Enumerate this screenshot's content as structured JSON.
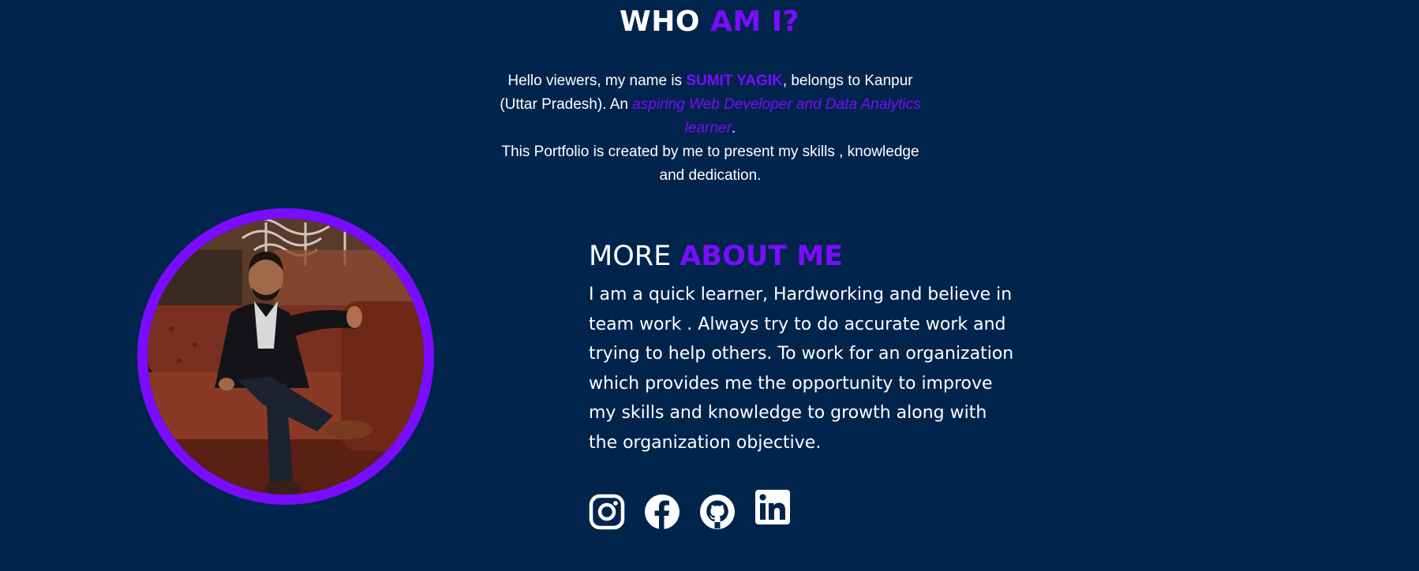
{
  "who": {
    "title_white": "WHO",
    "title_accent": "AM I?"
  },
  "intro": {
    "text_before_name": "Hello viewers, my name is ",
    "name": "SUMIT YAGIK",
    "text_after_name": ", belongs to Kanpur (Uttar Pradesh). An ",
    "role": "aspiring Web Developer and Data Analytics learner",
    "text_after_role": ".",
    "line2": "This Portfolio is created by me to present my skills , knowledge and dedication."
  },
  "about": {
    "title_white": "MORE",
    "title_accent": "ABOUT ME",
    "paragraph": "I am a quick learner, Hardworking and believe in team work . Always try to do accurate work and trying to help others. To work for an organization which provides me the opportunity to improve my skills and knowledge to growth along with the organization objective."
  },
  "socials": [
    {
      "name": "instagram",
      "icon": "instagram-icon"
    },
    {
      "name": "facebook",
      "icon": "facebook-icon"
    },
    {
      "name": "github",
      "icon": "github-icon"
    },
    {
      "name": "linkedin",
      "icon": "linkedin-icon"
    }
  ],
  "colors": {
    "background": "#01244d",
    "accent": "#7a0cff",
    "text": "#ffffff"
  }
}
